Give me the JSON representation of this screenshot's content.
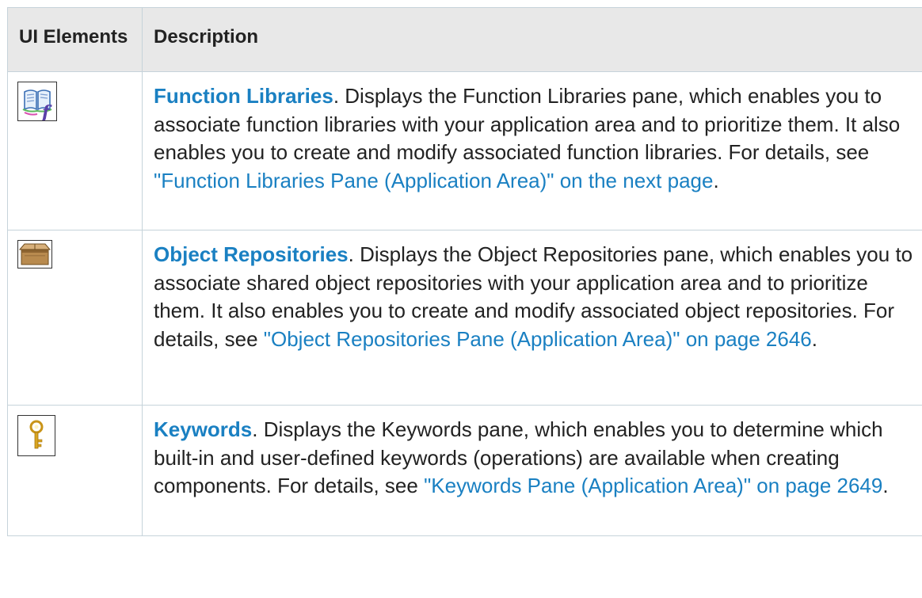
{
  "table": {
    "headers": {
      "ui_elements": "UI Elements",
      "description": "Description"
    },
    "rows": [
      {
        "icon": "function-library-book-icon",
        "term": "Function Libraries",
        "text": ". Displays the Function Libraries pane, which enables you to associate function libraries with your application area and to prioritize them. It also enables you to create and modify associated function libraries. For details, see ",
        "link": "\"Function Libraries Pane (Application Area)\" on the next page",
        "end": "."
      },
      {
        "icon": "object-repository-box-icon",
        "term": "Object Repositories",
        "text": ". Displays the Object Repositories pane, which enables you to associate shared object repositories with your application area and to prioritize them. It also enables you to create and modify associated object repositories. For details, see ",
        "link": "\"Object Repositories Pane (Application Area)\" on page 2646",
        "end": "."
      },
      {
        "icon": "keyword-key-icon",
        "term": "Keywords",
        "text": ". Displays the Keywords pane, which enables you to determine which built-in and user-defined keywords (operations) are available when creating components. For details, see ",
        "link": "\"Keywords Pane (Application Area)\" on page 2649",
        "end": "."
      }
    ]
  },
  "colors": {
    "header_bg": "#e8e8e8",
    "border": "#c6d3da",
    "link": "#1a80c2"
  }
}
